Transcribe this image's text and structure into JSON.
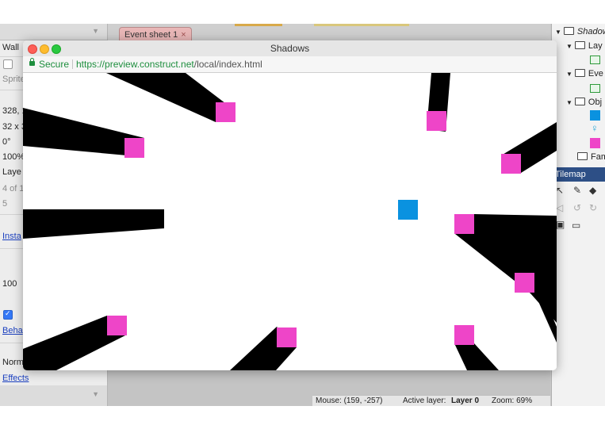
{
  "editor": {
    "tab_label": "Event sheet 1",
    "tab_close": "×",
    "left_panel": {
      "object_name": "Wall",
      "type_label": "Sprite",
      "position": "328, 1",
      "size": "32 x 3",
      "angle": "0°",
      "opacity": "100%",
      "layer": "Laye",
      "z_index": "4 of 1",
      "uid": "5",
      "instance_link": "Insta",
      "value": "100",
      "behaviors_link": "Beha",
      "blend": "Norm",
      "effects_link": "Effects"
    },
    "statusbar": {
      "mouse": "Mouse: (159, -257)",
      "active_layer_label": "Active layer:",
      "active_layer_value": "Layer 0",
      "zoom": "Zoom: 69%"
    },
    "project_tree": {
      "root": "Shadow",
      "layouts": "Lay",
      "event_sheets": "Eve",
      "object_types": "Obj",
      "families": "Fam"
    },
    "tilemap_header": "Tilemap"
  },
  "window": {
    "title": "Shadows",
    "secure_label": "Secure",
    "url_host": "https://preview.construct.net",
    "url_path": "/local/index.html"
  },
  "colors": {
    "shadow": "#000000",
    "wall_sprite": "#ee45c8",
    "light_sprite": "#0a92e0",
    "tilemap_header": "#2d4f86",
    "secure_green": "#1e8e3e"
  },
  "icons": {
    "lock": "lock-icon",
    "folder": "folder-icon",
    "light": "lightbulb-icon"
  }
}
